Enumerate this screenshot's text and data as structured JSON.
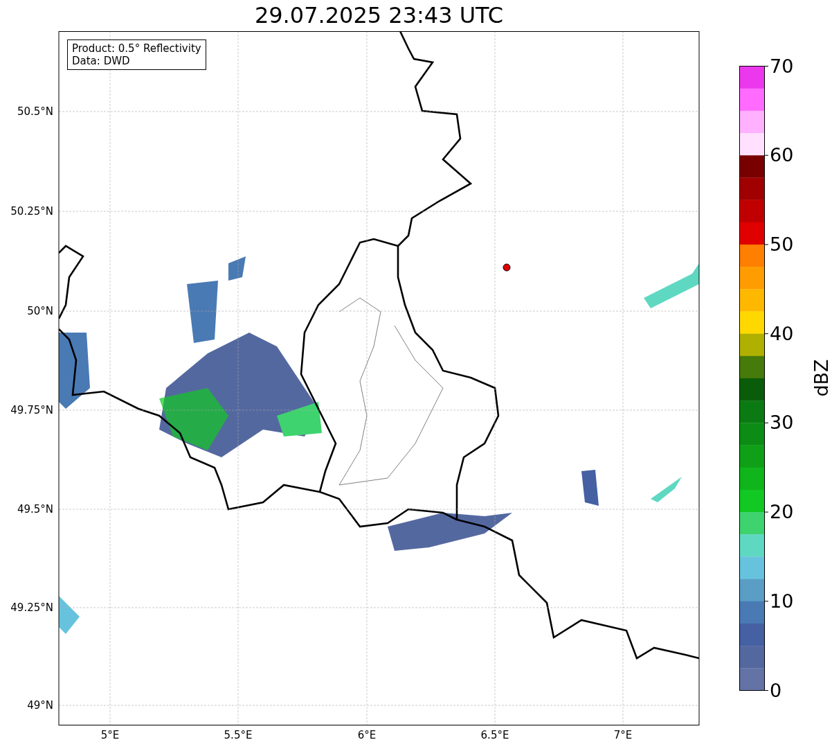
{
  "title": "29.07.2025 23:43 UTC",
  "info_box": [
    "Product: 0.5° Reflectivity",
    "Data: DWD"
  ],
  "lat_ticks": [
    "50.5°N",
    "50.25°N",
    "50°N",
    "49.75°N",
    "49.5°N",
    "49.25°N",
    "49°N"
  ],
  "lon_ticks": [
    "5°E",
    "5.5°E",
    "6°E",
    "6.5°E",
    "7°E"
  ],
  "colorbar": {
    "label": "dBZ",
    "ticks": [
      "70",
      "60",
      "50",
      "40",
      "30",
      "20",
      "10",
      "0"
    ],
    "bands": [
      {
        "color": "#ec38ec"
      },
      {
        "color": "#ff6bff"
      },
      {
        "color": "#ffb0ff"
      },
      {
        "color": "#ffe0ff"
      },
      {
        "color": "#780000"
      },
      {
        "color": "#a00000"
      },
      {
        "color": "#c00000"
      },
      {
        "color": "#e00000"
      },
      {
        "color": "#ff7f00"
      },
      {
        "color": "#ff9c00"
      },
      {
        "color": "#ffb800"
      },
      {
        "color": "#ffd800"
      },
      {
        "color": "#b0b000"
      },
      {
        "color": "#467a0a"
      },
      {
        "color": "#0a5c0a"
      },
      {
        "color": "#0c7a12"
      },
      {
        "color": "#0c8c14"
      },
      {
        "color": "#10a018"
      },
      {
        "color": "#10b51c"
      },
      {
        "color": "#12c823"
      },
      {
        "color": "#3ed36f"
      },
      {
        "color": "#5fd8c2"
      },
      {
        "color": "#67c3dd"
      },
      {
        "color": "#5a9ec6"
      },
      {
        "color": "#4a7ab4"
      },
      {
        "color": "#4560a3"
      },
      {
        "color": "#5468a0"
      },
      {
        "color": "#6473a5"
      }
    ]
  }
}
